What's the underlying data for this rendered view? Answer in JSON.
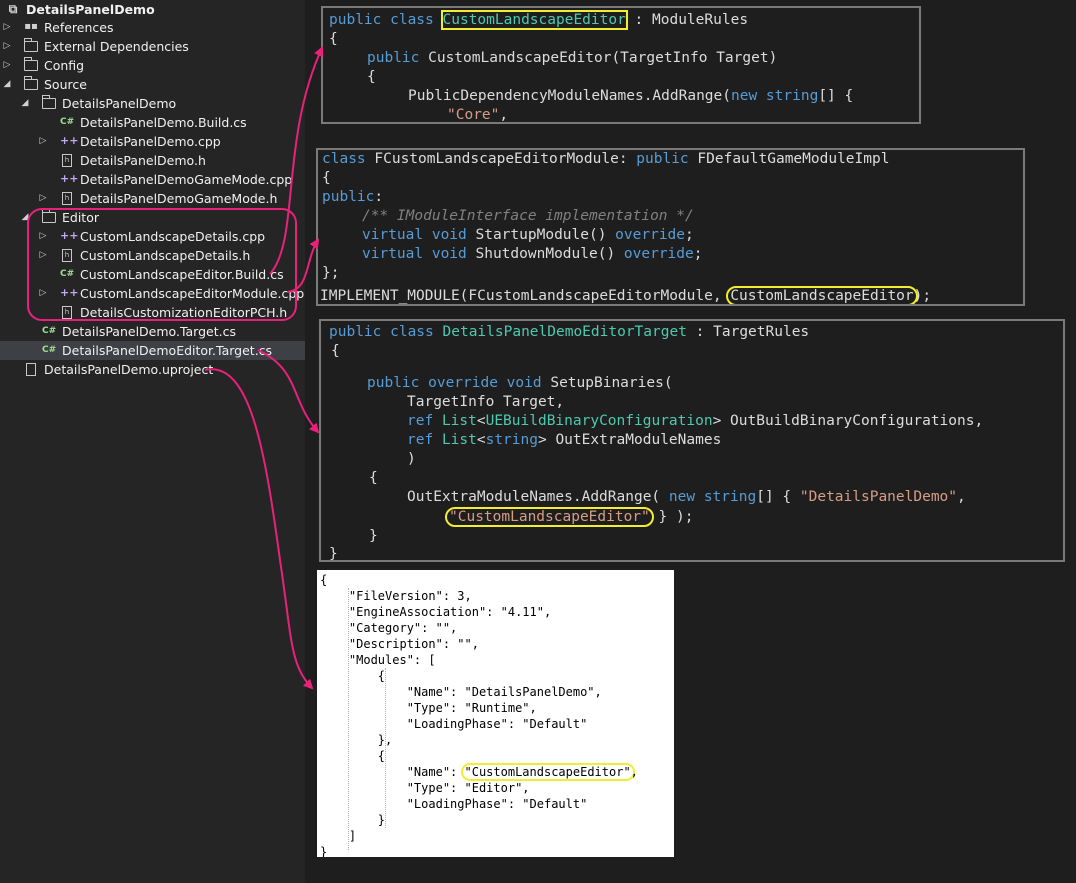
{
  "tree": {
    "solution_title": "DetailsPanelDemo",
    "items": [
      {
        "label": "References"
      },
      {
        "label": "External Dependencies"
      },
      {
        "label": "Config"
      },
      {
        "label": "Source"
      },
      {
        "label": "DetailsPanelDemo"
      },
      {
        "label": "DetailsPanelDemo.Build.cs"
      },
      {
        "label": "DetailsPanelDemo.cpp"
      },
      {
        "label": "DetailsPanelDemo.h"
      },
      {
        "label": "DetailsPanelDemoGameMode.cpp"
      },
      {
        "label": "DetailsPanelDemoGameMode.h"
      },
      {
        "label": "Editor"
      },
      {
        "label": "CustomLandscapeDetails.cpp"
      },
      {
        "label": "CustomLandscapeDetails.h"
      },
      {
        "label": "CustomLandscapeEditor.Build.cs"
      },
      {
        "label": "CustomLandscapeEditorModule.cpp"
      },
      {
        "label": "DetailsCustomizationEditorPCH.h"
      },
      {
        "label": "DetailsPanelDemo.Target.cs"
      },
      {
        "label": "DetailsPanelDemoEditor.Target.cs"
      },
      {
        "label": "DetailsPanelDemo.uproject"
      }
    ],
    "icon_labels": {
      "cs": "C#",
      "cpp": "++",
      "h": "h"
    }
  },
  "build_cs": {
    "l1_kw": "public class",
    "l1_name": "CustomLandscapeEditor",
    "l1_rest": " : ModuleRules",
    "l2": "{",
    "l3_kw": "public",
    "l3_rest": " CustomLandscapeEditor(TargetInfo Target)",
    "l4": "{",
    "l5_a": "PublicDependencyModuleNames.AddRange(",
    "l5_kw": "new string",
    "l5_b": "[] {",
    "l6_str": "\"Core\"",
    "l6_rest": ","
  },
  "module_cpp": {
    "l1_kw": "class",
    "l1_a": " FCustomLandscapeEditorModule: ",
    "l1_kw2": "public",
    "l1_b": " FDefaultGameModuleImpl",
    "l2": "{",
    "l3_kw": "public",
    "l3_rest": ":",
    "l4_cm": "/** IModuleInterface implementation */",
    "l5_kw": "virtual void",
    "l5_a": " StartupModule() ",
    "l5_kw2": "override",
    "l5_b": ";",
    "l6_kw": "virtual void",
    "l6_a": " ShutdownModule() ",
    "l6_kw2": "override",
    "l6_b": ";",
    "l7": "};",
    "l8_a": "IMPLEMENT_MODULE(FCustomLandscapeEditorModule, ",
    "l8_name": "CustomLandscapeEditor",
    "l8_b": ");"
  },
  "target_cs": {
    "l1_kw": "public class",
    "l1_name": "DetailsPanelDemoEditorTarget",
    "l1_rest": " : TargetRules",
    "l2": "{",
    "l3_kw": "public override void",
    "l3_rest": " SetupBinaries(",
    "l4": "TargetInfo Target,",
    "l5_kw": "ref",
    "l5_ty": "List",
    "l5_a": "<",
    "l5_ty2": "UEBuildBinaryConfiguration",
    "l5_b": "> OutBuildBinaryConfigurations,",
    "l6_kw": "ref",
    "l6_ty": "List",
    "l6_a": "<",
    "l6_kw2": "string",
    "l6_b": "> OutExtraModuleNames",
    "l7": ")",
    "l8": "{",
    "l9_a": "OutExtraModuleNames.AddRange( ",
    "l9_kw": "new string",
    "l9_b": "[] { ",
    "l9_str": "\"DetailsPanelDemo\"",
    "l9_c": ",",
    "l10_str": "\"CustomLandscapeEditor\"",
    "l10_rest": " } );",
    "l11": "}",
    "l12": "}"
  },
  "uproject": {
    "lines": [
      "{",
      "    \"FileVersion\": 3,",
      "    \"EngineAssociation\": \"4.11\",",
      "    \"Category\": \"\",",
      "    \"Description\": \"\",",
      "    \"Modules\": [",
      "        {",
      "            \"Name\": \"DetailsPanelDemo\",",
      "            \"Type\": \"Runtime\",",
      "            \"LoadingPhase\": \"Default\"",
      "        },",
      "        {",
      "            \"Name\": ",
      "            \"Type\": \"Editor\",",
      "            \"LoadingPhase\": \"Default\"",
      "        }",
      "    ]",
      "}"
    ],
    "highlight_name": "\"CustomLandscapeEditor\"",
    "highlight_tail": ","
  },
  "colors": {
    "arrow": "#e8217a",
    "highlight": "#f2ee2f",
    "keyword": "#569cd6",
    "type": "#4ec9b0",
    "string": "#d69d85"
  }
}
